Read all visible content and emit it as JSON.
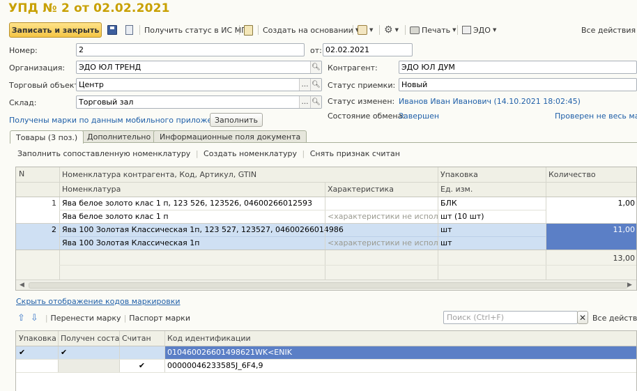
{
  "window": {
    "title": "УПД № 2 от 02.02.2021"
  },
  "toolbar": {
    "save_close": "Записать и закрыть",
    "get_status": "Получить статус в ИС МП",
    "create_based": "Создать на основании",
    "print": "Печать",
    "edo": "ЭДО",
    "all_actions": "Все действия"
  },
  "form": {
    "number_label": "Номер:",
    "number_value": "2",
    "date_label": "от:",
    "date_value": "02.02.2021",
    "org_label": "Организация:",
    "org_value": "ЭДО ЮЛ ТРЕНД",
    "contractor_label": "Контрагент:",
    "contractor_value": "ЭДО ЮЛ ДУМ",
    "trade_object_label": "Торговый объект:",
    "trade_object_value": "Центр",
    "accept_status_label": "Статус приемки:",
    "accept_status_value": "Новый",
    "warehouse_label": "Склад:",
    "warehouse_value": "Торговый зал",
    "status_changed_label": "Статус изменен:",
    "status_changed_value": "Иванов Иван Иванович (14.10.2021 18:02:45)",
    "exchange_state_label": "Состояние обмена:",
    "exchange_state_value": "Завершен",
    "marks_received_link": "Получены марки по данным мобильного приложения",
    "fill_button": "Заполнить",
    "checked_link": "Проверен не весь марк"
  },
  "tabs": [
    {
      "label": "Товары (3 поз.)"
    },
    {
      "label": "Дополнительно"
    },
    {
      "label": "Информационные поля документа"
    }
  ],
  "goods_toolbar": {
    "fill_mapped": "Заполнить сопоставленную номенклатуру",
    "create_nomenclature": "Создать номенклатуру",
    "remove_scanned": "Снять признак считан"
  },
  "goods_table": {
    "headers": {
      "n": "N",
      "contractor_nom": "Номенклатура контрагента, Код, Артикул, GTIN",
      "packaging": "Упаковка",
      "quantity": "Количество",
      "nomenclature": "Номенклатура",
      "characteristic": "Характеристика",
      "unit": "Ед. изм."
    },
    "rows": [
      {
        "n": "1",
        "contractor_nom": "Ява белое золото клас 1 п, 123 526, 123526, 04600266012593",
        "packaging": "БЛК",
        "quantity": "1,00",
        "nomenclature": "Ява белое золото клас 1 п",
        "characteristic": "<характеристики не исполь...",
        "unit": "шт (10 шт)"
      },
      {
        "n": "2",
        "contractor_nom": "Ява 100 Золотая Классическая 1п, 123 527, 123527, 04600266014986",
        "packaging": "шт",
        "quantity": "11,00",
        "nomenclature": "Ява 100 Золотая Классическая 1п",
        "characteristic": "<характеристики не исполь...",
        "unit": "шт"
      }
    ],
    "total_quantity": "13,00"
  },
  "marks_section": {
    "hide_codes_link": "Скрыть отображение кодов маркировки",
    "move_mark": "Перенести марку",
    "mark_passport": "Паспорт марки",
    "search_placeholder": "Поиск (Ctrl+F)",
    "all_actions": "Все действия"
  },
  "marks_table": {
    "headers": {
      "packaging": "Упаковка",
      "composition": "Получен состав",
      "scanned": "Считан",
      "code": "Код идентификации"
    },
    "rows": [
      {
        "packaging": "✔",
        "composition": "✔",
        "scanned": "",
        "code": "010460026601498621WK<ENIK"
      },
      {
        "packaging": "",
        "composition": "",
        "scanned": "✔",
        "code": "00000046233585J_6F4,9"
      }
    ]
  },
  "colors": {
    "title": "#c8a000",
    "link": "#1f5fa8",
    "selected_row": "#cfe0f3",
    "selected_cell": "#5b7fc6"
  }
}
